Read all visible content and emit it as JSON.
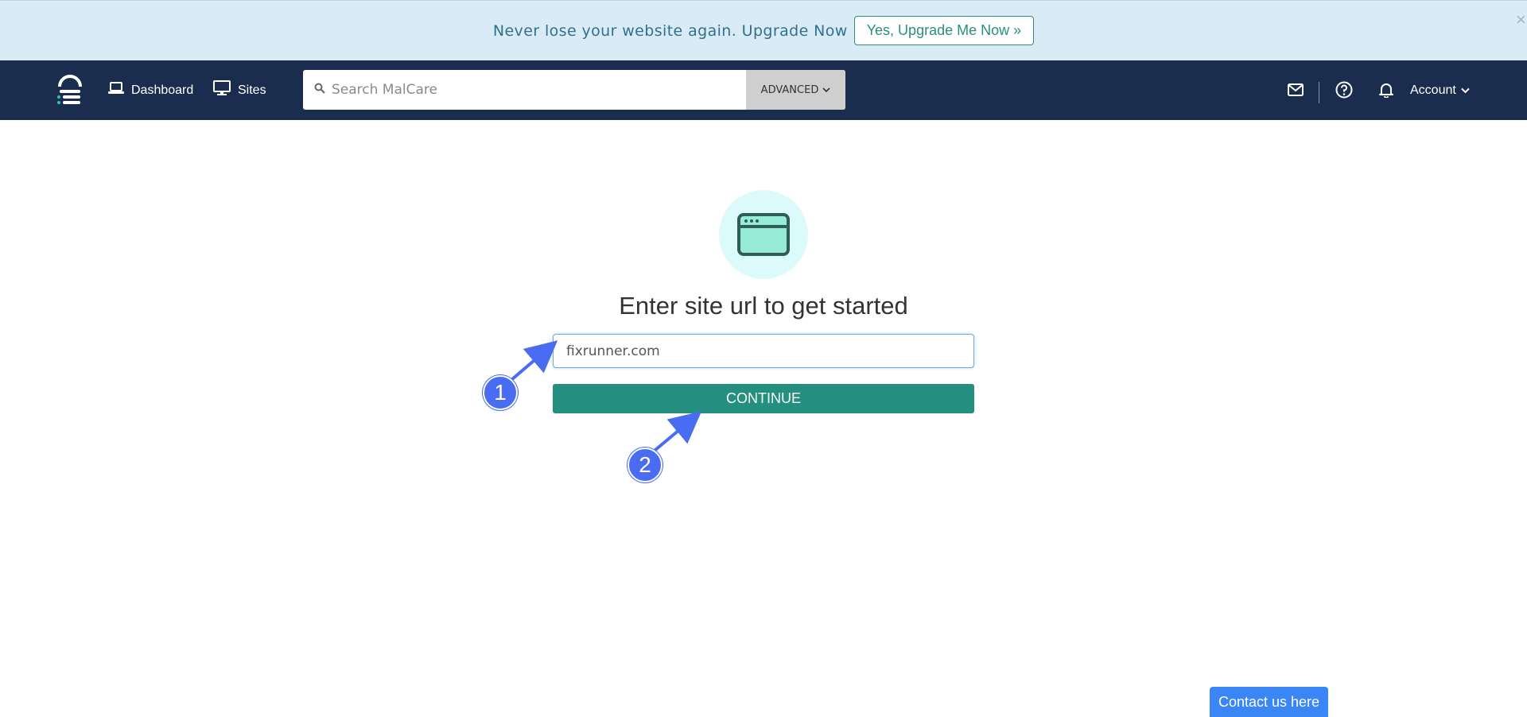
{
  "promo": {
    "text": "Never lose your website again. Upgrade Now",
    "button_label": "Yes, Upgrade Me Now »",
    "close_icon": "close-icon"
  },
  "navbar": {
    "logo_icon": "malcare-logo-icon",
    "links": [
      {
        "label": "Dashboard",
        "icon": "laptop-icon"
      },
      {
        "label": "Sites",
        "icon": "monitor-icon"
      }
    ],
    "search": {
      "placeholder": "Search MalCare",
      "value": "",
      "icon": "search-icon",
      "advanced_label": "ADVANCED"
    },
    "icons": [
      "mail-icon",
      "help-icon",
      "bell-icon"
    ],
    "account_label": "Account"
  },
  "main": {
    "hero_icon": "browser-window-icon",
    "heading": "Enter site url to get started",
    "url_input_value": "fixrunner.com",
    "continue_label": "CONTINUE"
  },
  "annotations": [
    {
      "label": "1",
      "target": "url-input"
    },
    {
      "label": "2",
      "target": "continue-button"
    }
  ],
  "contact_label": "Contact us here",
  "colors": {
    "promo_bg": "#d9ecf5",
    "nav_bg": "#1b2d4f",
    "accent_green": "#248f7e",
    "annotation_blue": "#4a6cf2",
    "contact_blue": "#3b86f7"
  }
}
